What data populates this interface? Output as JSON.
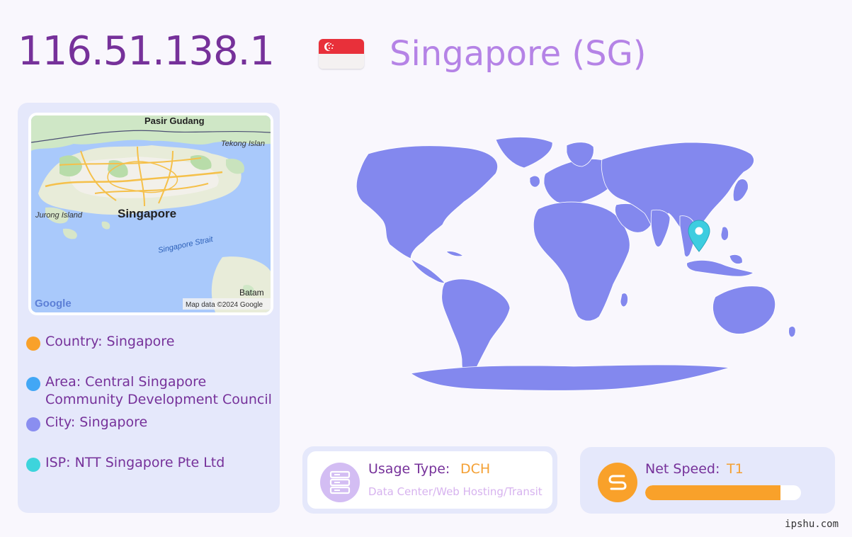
{
  "header": {
    "ip": "116.51.138.1",
    "country_title": "Singapore (SG)"
  },
  "mini_map": {
    "labels": {
      "pasir_gudang": "Pasir Gudang",
      "tekong": "Tekong Islan",
      "jurong": "Jurong Island",
      "singapore": "Singapore",
      "strait": "Singapore Strait",
      "batam": "Batam"
    },
    "logo": "Google",
    "attribution": "Map data ©2024 Google"
  },
  "info": {
    "country": "Country: Singapore",
    "area": "Area: Central Singapore Community Development Council",
    "city": "City: Singapore",
    "isp": "ISP: NTT Singapore Pte Ltd"
  },
  "colors": {
    "country_dot": "#f9a12a",
    "area_dot": "#42a7f5",
    "city_dot": "#8a8ef0",
    "isp_dot": "#3dd4dc",
    "world_fill": "#8388ee",
    "marker": "#3dcde0"
  },
  "usage": {
    "label": "Usage Type:",
    "value": "DCH",
    "description": "Data Center/Web Hosting/Transit",
    "icon": "server-icon"
  },
  "speed": {
    "label": "Net Speed:",
    "value": "T1",
    "level_percent": 87,
    "icon": "speed-s-icon"
  },
  "footer": {
    "site": "ipshu.com"
  }
}
